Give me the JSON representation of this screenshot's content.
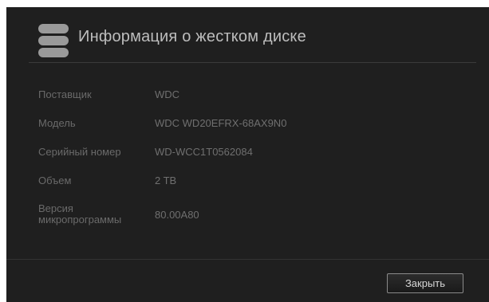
{
  "dialog": {
    "title": "Информация о жестком диске",
    "icon": "hard-drive-icon"
  },
  "info": [
    {
      "label": "Поставщик",
      "value": "WDC"
    },
    {
      "label": "Модель",
      "value": "WDC WD20EFRX-68AX9N0"
    },
    {
      "label": "Серийный номер",
      "value": "WD-WCC1T0562084"
    },
    {
      "label": "Объем",
      "value": "2 TB"
    },
    {
      "label_line1": "Версия",
      "label_line2": "микропрограммы",
      "value": "80.00A80"
    }
  ],
  "footer": {
    "close_label": "Закрыть"
  }
}
